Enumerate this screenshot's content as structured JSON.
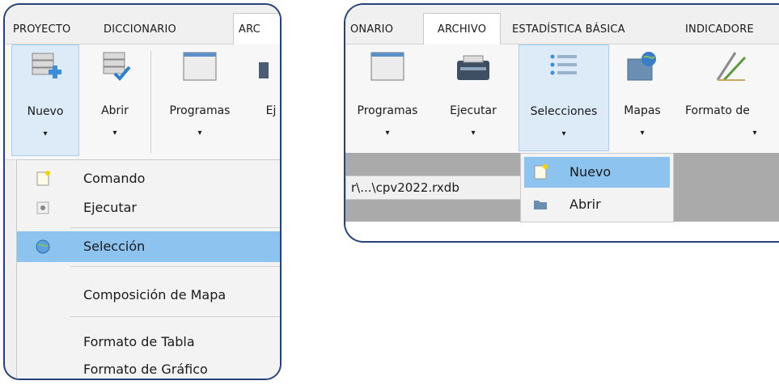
{
  "left": {
    "tabs": [
      "PROYECTO",
      "DICCIONARIO",
      "ARC"
    ],
    "ribbon": [
      {
        "label": "Nuevo",
        "icon": "database-add-icon",
        "arrow": "▾"
      },
      {
        "label": "Abrir",
        "icon": "database-check-icon",
        "arrow": "▾"
      },
      {
        "label": "Programas",
        "icon": "window-icon",
        "arrow": "▾"
      },
      {
        "label": "Ej",
        "icon": "run-icon"
      }
    ],
    "menu": [
      {
        "label": "Comando",
        "icon": "note-icon"
      },
      {
        "label": "Ejecutar",
        "icon": "execute-icon"
      },
      {
        "label": "Selección",
        "icon": "globe-icon",
        "selected": true
      },
      {
        "label": "Composición de Mapa"
      },
      {
        "label": "Formato de Tabla"
      },
      {
        "label": "Formato de Gráfico"
      }
    ]
  },
  "right": {
    "tabs": [
      "ONARIO",
      "ARCHIVO",
      "ESTADÍSTICA BÁSICA",
      "INDICADORE"
    ],
    "ribbon": [
      {
        "label": "Programas",
        "icon": "window-icon",
        "arrow": "▾"
      },
      {
        "label": "Ejecutar",
        "icon": "printer-icon",
        "arrow": "▾"
      },
      {
        "label": "Selecciones",
        "icon": "list-icon",
        "arrow": "▾"
      },
      {
        "label": "Mapas",
        "icon": "map-folder-icon",
        "arrow": "▾"
      },
      {
        "label": "Formato de",
        "icon": "drafting-icon",
        "arrow": "▾"
      }
    ],
    "path": "r\\...\\cpv2022.rxdb",
    "menu": [
      {
        "label": "Nuevo",
        "icon": "note-icon",
        "selected": true
      },
      {
        "label": "Abrir",
        "icon": "folder-icon"
      }
    ]
  },
  "colors": {
    "frame_border": "#25427a",
    "selected_item": "#8cc3ef",
    "hover_button": "#dcebf7"
  }
}
